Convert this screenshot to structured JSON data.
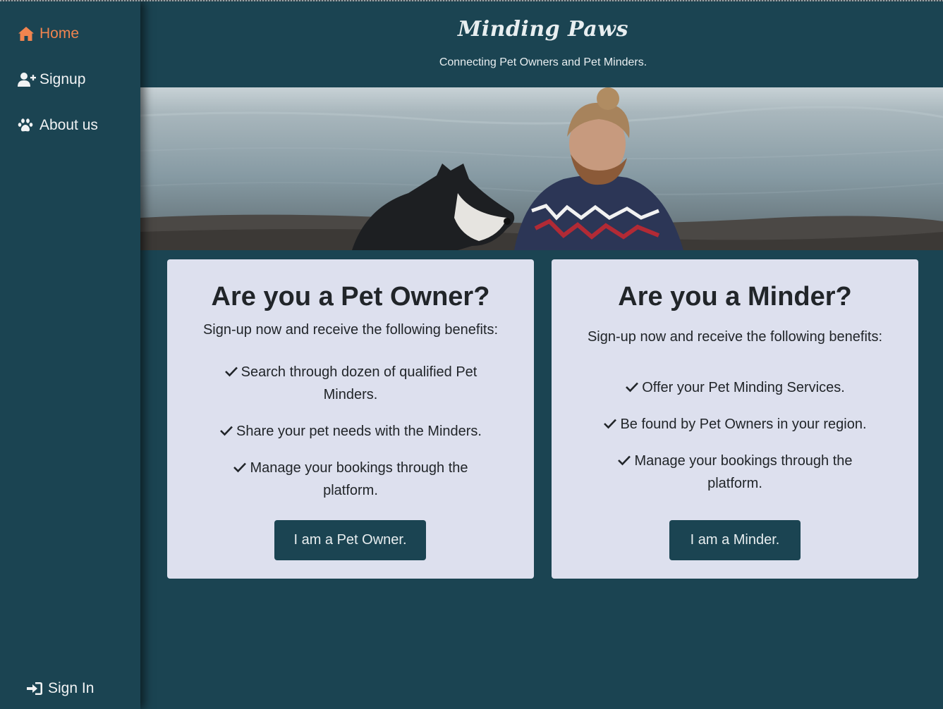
{
  "sidebar": {
    "items": [
      {
        "label": "Home",
        "icon": "house-icon",
        "active": true
      },
      {
        "label": "Signup",
        "icon": "user-plus-icon"
      },
      {
        "label": "About us",
        "icon": "paw-icon"
      }
    ],
    "signin": {
      "label": "Sign In",
      "icon": "sign-in-icon"
    }
  },
  "header": {
    "brand": "Minding Paws",
    "tagline": "Connecting Pet Owners and Pet Minders."
  },
  "owner_card": {
    "title": "Are you a Pet Owner?",
    "intro": "Sign-up now and receive the following benefits:",
    "benefits": [
      "Search through dozen of qualified Pet Minders.",
      "Share your pet needs with the Minders.",
      "Manage your bookings through the platform."
    ],
    "button": "I am a Pet Owner."
  },
  "minder_card": {
    "title": "Are you a Minder?",
    "intro": "Sign-up now and receive the following benefits:",
    "benefits": [
      "Offer your Pet Minding Services.",
      "Be found by Pet Owners in your region.",
      "Manage your bookings through the platform."
    ],
    "button": "I am a Minder."
  },
  "colors": {
    "background": "#1b4452",
    "accent": "#f0844f",
    "card": "#dde0ee",
    "button": "#1b4452"
  }
}
